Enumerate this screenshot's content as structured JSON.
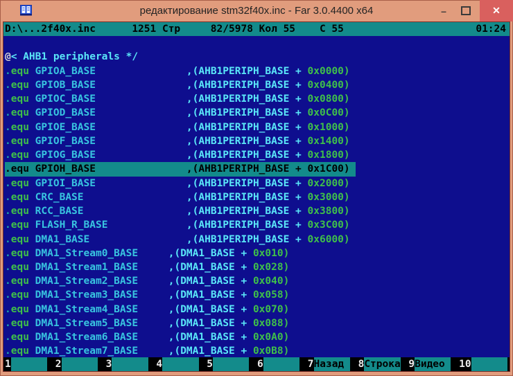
{
  "window": {
    "title": "редактирование stm32f40x.inc - Far 3.0.4400 x64"
  },
  "controls": {
    "minimize": "–",
    "close": "✕"
  },
  "icons": {
    "app": "far-manager-icon",
    "maximize": "outlined-square",
    "close_glyph": "x-cross"
  },
  "statusbar": {
    "left": "D:\\...2f40x.inc      1251 Стр     82/5978 Кол 55    С 55",
    "time": "01:24"
  },
  "editor": {
    "lines": [
      {
        "seg": []
      },
      {
        "seg": [
          [
            "w",
            "@"
          ],
          [
            "c",
            "< AHB1 peripherals */"
          ]
        ]
      },
      {
        "seg": [
          [
            "d",
            "."
          ],
          [
            "k",
            "equ"
          ],
          [
            "n",
            " GPIOA_BASE               "
          ],
          [
            "r",
            ",(AHB1PERIPH_BASE + "
          ],
          [
            "v",
            "0x0000)"
          ]
        ]
      },
      {
        "seg": [
          [
            "d",
            "."
          ],
          [
            "k",
            "equ"
          ],
          [
            "n",
            " GPIOB_BASE               "
          ],
          [
            "r",
            ",(AHB1PERIPH_BASE + "
          ],
          [
            "v",
            "0x0400)"
          ]
        ]
      },
      {
        "seg": [
          [
            "d",
            "."
          ],
          [
            "k",
            "equ"
          ],
          [
            "n",
            " GPIOC_BASE               "
          ],
          [
            "r",
            ",(AHB1PERIPH_BASE + "
          ],
          [
            "v",
            "0x0800)"
          ]
        ]
      },
      {
        "seg": [
          [
            "d",
            "."
          ],
          [
            "k",
            "equ"
          ],
          [
            "n",
            " GPIOD_BASE               "
          ],
          [
            "r",
            ",(AHB1PERIPH_BASE + "
          ],
          [
            "v",
            "0x0C00)"
          ]
        ]
      },
      {
        "seg": [
          [
            "d",
            "."
          ],
          [
            "k",
            "equ"
          ],
          [
            "n",
            " GPIOE_BASE               "
          ],
          [
            "r",
            ",(AHB1PERIPH_BASE + "
          ],
          [
            "v",
            "0x1000)"
          ]
        ]
      },
      {
        "seg": [
          [
            "d",
            "."
          ],
          [
            "k",
            "equ"
          ],
          [
            "n",
            " GPIOF_BASE               "
          ],
          [
            "r",
            ",(AHB1PERIPH_BASE + "
          ],
          [
            "v",
            "0x1400)"
          ]
        ]
      },
      {
        "seg": [
          [
            "d",
            "."
          ],
          [
            "k",
            "equ"
          ],
          [
            "n",
            " GPIOG_BASE               "
          ],
          [
            "r",
            ",(AHB1PERIPH_BASE + "
          ],
          [
            "v",
            "0x1800)"
          ]
        ]
      },
      {
        "selected": true,
        "seg": [
          [
            "d",
            "."
          ],
          [
            "k",
            "equ"
          ],
          [
            "n",
            " GPIOH_BASE               "
          ],
          [
            "r",
            ",(AHB1PERIPH_BASE + "
          ],
          [
            "v",
            "0x1C00)"
          ],
          [
            "n",
            " "
          ]
        ]
      },
      {
        "seg": [
          [
            "d",
            "."
          ],
          [
            "k",
            "equ"
          ],
          [
            "n",
            " GPIOI_BASE               "
          ],
          [
            "r",
            ",(AHB1PERIPH_BASE + "
          ],
          [
            "v",
            "0x2000)"
          ]
        ]
      },
      {
        "seg": [
          [
            "d",
            "."
          ],
          [
            "k",
            "equ"
          ],
          [
            "n",
            " CRC_BASE                 "
          ],
          [
            "r",
            ",(AHB1PERIPH_BASE + "
          ],
          [
            "v",
            "0x3000)"
          ]
        ]
      },
      {
        "seg": [
          [
            "d",
            "."
          ],
          [
            "k",
            "equ"
          ],
          [
            "n",
            " RCC_BASE                 "
          ],
          [
            "r",
            ",(AHB1PERIPH_BASE + "
          ],
          [
            "v",
            "0x3800)"
          ]
        ]
      },
      {
        "seg": [
          [
            "d",
            "."
          ],
          [
            "k",
            "equ"
          ],
          [
            "n",
            " FLASH_R_BASE             "
          ],
          [
            "r",
            ",(AHB1PERIPH_BASE + "
          ],
          [
            "v",
            "0x3C00)"
          ]
        ]
      },
      {
        "seg": [
          [
            "d",
            "."
          ],
          [
            "k",
            "equ"
          ],
          [
            "n",
            " DMA1_BASE                "
          ],
          [
            "r",
            ",(AHB1PERIPH_BASE + "
          ],
          [
            "v",
            "0x6000)"
          ]
        ]
      },
      {
        "seg": [
          [
            "d",
            "."
          ],
          [
            "k",
            "equ"
          ],
          [
            "n",
            " DMA1_Stream0_BASE     "
          ],
          [
            "r",
            ",(DMA1_BASE + "
          ],
          [
            "v",
            "0x010)"
          ]
        ]
      },
      {
        "seg": [
          [
            "d",
            "."
          ],
          [
            "k",
            "equ"
          ],
          [
            "n",
            " DMA1_Stream1_BASE     "
          ],
          [
            "r",
            ",(DMA1_BASE + "
          ],
          [
            "v",
            "0x028)"
          ]
        ]
      },
      {
        "seg": [
          [
            "d",
            "."
          ],
          [
            "k",
            "equ"
          ],
          [
            "n",
            " DMA1_Stream2_BASE     "
          ],
          [
            "r",
            ",(DMA1_BASE + "
          ],
          [
            "v",
            "0x040)"
          ]
        ]
      },
      {
        "seg": [
          [
            "d",
            "."
          ],
          [
            "k",
            "equ"
          ],
          [
            "n",
            " DMA1_Stream3_BASE     "
          ],
          [
            "r",
            ",(DMA1_BASE + "
          ],
          [
            "v",
            "0x058)"
          ]
        ]
      },
      {
        "seg": [
          [
            "d",
            "."
          ],
          [
            "k",
            "equ"
          ],
          [
            "n",
            " DMA1_Stream4_BASE     "
          ],
          [
            "r",
            ",(DMA1_BASE + "
          ],
          [
            "v",
            "0x070)"
          ]
        ]
      },
      {
        "seg": [
          [
            "d",
            "."
          ],
          [
            "k",
            "equ"
          ],
          [
            "n",
            " DMA1_Stream5_BASE     "
          ],
          [
            "r",
            ",(DMA1_BASE + "
          ],
          [
            "v",
            "0x088)"
          ]
        ]
      },
      {
        "seg": [
          [
            "d",
            "."
          ],
          [
            "k",
            "equ"
          ],
          [
            "n",
            " DMA1_Stream6_BASE     "
          ],
          [
            "r",
            ",(DMA1_BASE + "
          ],
          [
            "v",
            "0x0A0)"
          ]
        ]
      },
      {
        "seg": [
          [
            "d",
            "."
          ],
          [
            "k",
            "equ"
          ],
          [
            "n",
            " DMA1_Stream7_BASE     "
          ],
          [
            "r",
            ",(DMA1_BASE + "
          ],
          [
            "v",
            "0x0B8)"
          ]
        ]
      }
    ]
  },
  "keybar": {
    "keys": [
      {
        "num": "1",
        "label": ""
      },
      {
        "num": "2",
        "label": ""
      },
      {
        "num": "3",
        "label": ""
      },
      {
        "num": "4",
        "label": ""
      },
      {
        "num": "5",
        "label": ""
      },
      {
        "num": "6",
        "label": ""
      },
      {
        "num": "7",
        "label": "Назад"
      },
      {
        "num": "8",
        "label": "Строка"
      },
      {
        "num": "9",
        "label": "Видео"
      },
      {
        "num": "10",
        "label": ""
      }
    ]
  },
  "colors": {
    "titlebar_bg": "#e19c7d",
    "close_button_bg": "#d9605e",
    "console_bg": "#0e0e8e",
    "bar_teal": "#138b8b",
    "keyword_green": "#3fc04a",
    "identifier_cyan": "#38c4e0",
    "reference_cyan": "#5ae6f8",
    "selection_text": "#000000",
    "keybar_bg": "#000000"
  }
}
